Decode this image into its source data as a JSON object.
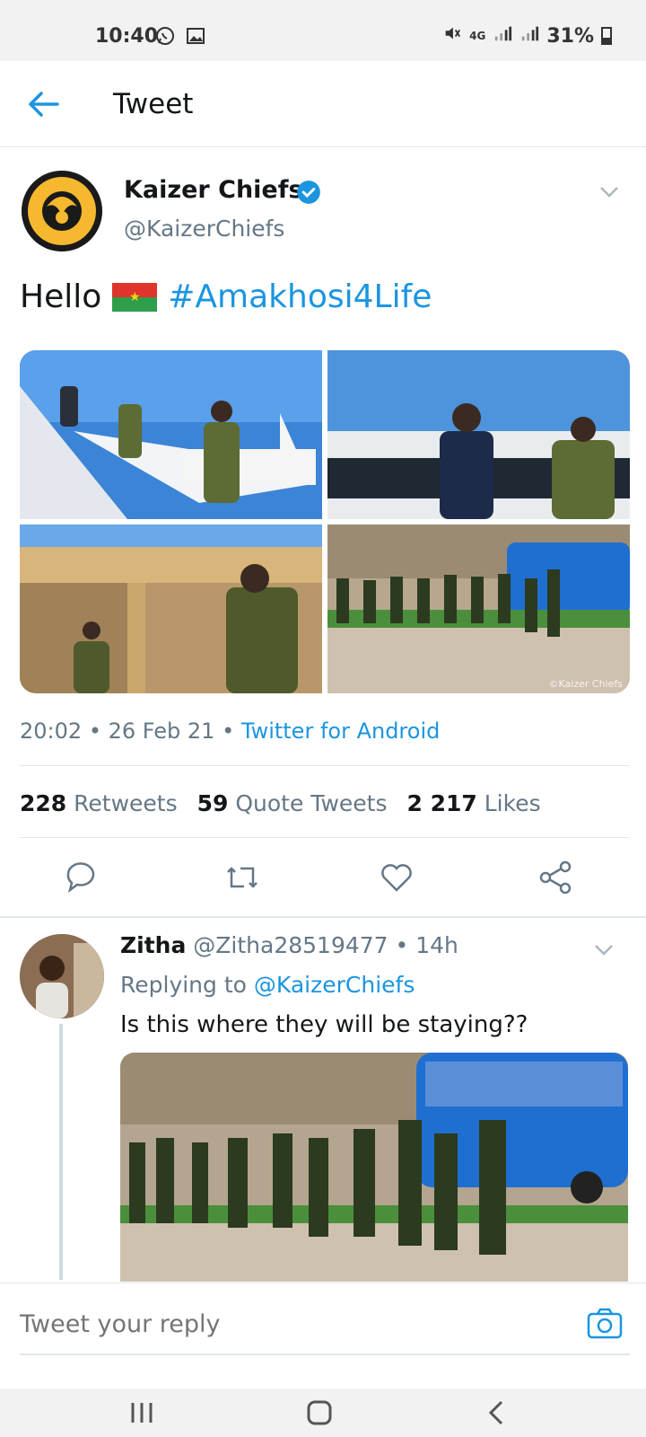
{
  "status_bar": {
    "time": "10:40",
    "battery": "31%",
    "icons": [
      "whatsapp-icon",
      "gallery-icon",
      "mute-icon",
      "4g-icon",
      "signal-icon",
      "signal-icon",
      "battery-icon"
    ]
  },
  "app_bar": {
    "title": "Tweet",
    "back_icon": "arrow-left-icon"
  },
  "tweet": {
    "author_name": "Kaizer Chiefs",
    "author_handle": "@KaizerChiefs",
    "text_hello": "Hello",
    "text_hashtag": "#Amakhosi4Life",
    "photo_credit": "©Kaizer Chiefs",
    "time": "20:02",
    "date": "26 Feb 21",
    "source": "Twitter for Android",
    "retweets_count": "228",
    "retweets_label": "Retweets",
    "quotes_count": "59",
    "quotes_label": "Quote Tweets",
    "likes_count": "2 217",
    "likes_label": "Likes"
  },
  "reply": {
    "name": "Zitha",
    "handle": "@Zitha28519477",
    "time": "14h",
    "replying_label": "Replying to",
    "replying_to": "@KaizerChiefs",
    "text": "Is this where they will be staying??"
  },
  "composer": {
    "placeholder": "Tweet your reply"
  },
  "colors": {
    "accent": "#1b95e0",
    "muted": "#657786",
    "text": "#14171a",
    "divider": "#e1e8ed"
  }
}
